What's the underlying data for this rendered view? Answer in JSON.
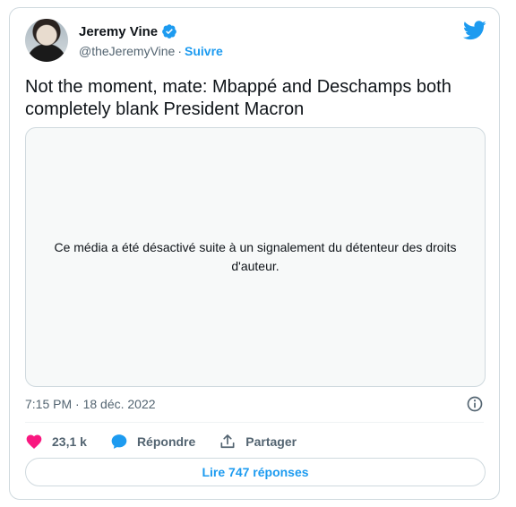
{
  "author": {
    "name": "Jeremy Vine",
    "handle": "@theJeremyVine",
    "separator": "·",
    "follow_label": "Suivre"
  },
  "tweet": {
    "text": "Not the moment, mate: Mbappé and Deschamps both completely blank President Macron",
    "media_message": "Ce média a été désactivé suite à un signalement du détenteur des droits d'auteur.",
    "timestamp": "7:15 PM · 18 déc. 2022"
  },
  "actions": {
    "likes_count": "23,1 k",
    "reply_label": "Répondre",
    "share_label": "Partager"
  },
  "read_replies_label": "Lire 747 réponses",
  "colors": {
    "accent": "#1d9bf0",
    "like": "#f91880",
    "text": "#0f1419",
    "muted": "#536471"
  },
  "icons": [
    "verified-icon",
    "twitter-logo-icon",
    "info-icon",
    "heart-icon",
    "reply-bubble-icon",
    "share-icon"
  ]
}
